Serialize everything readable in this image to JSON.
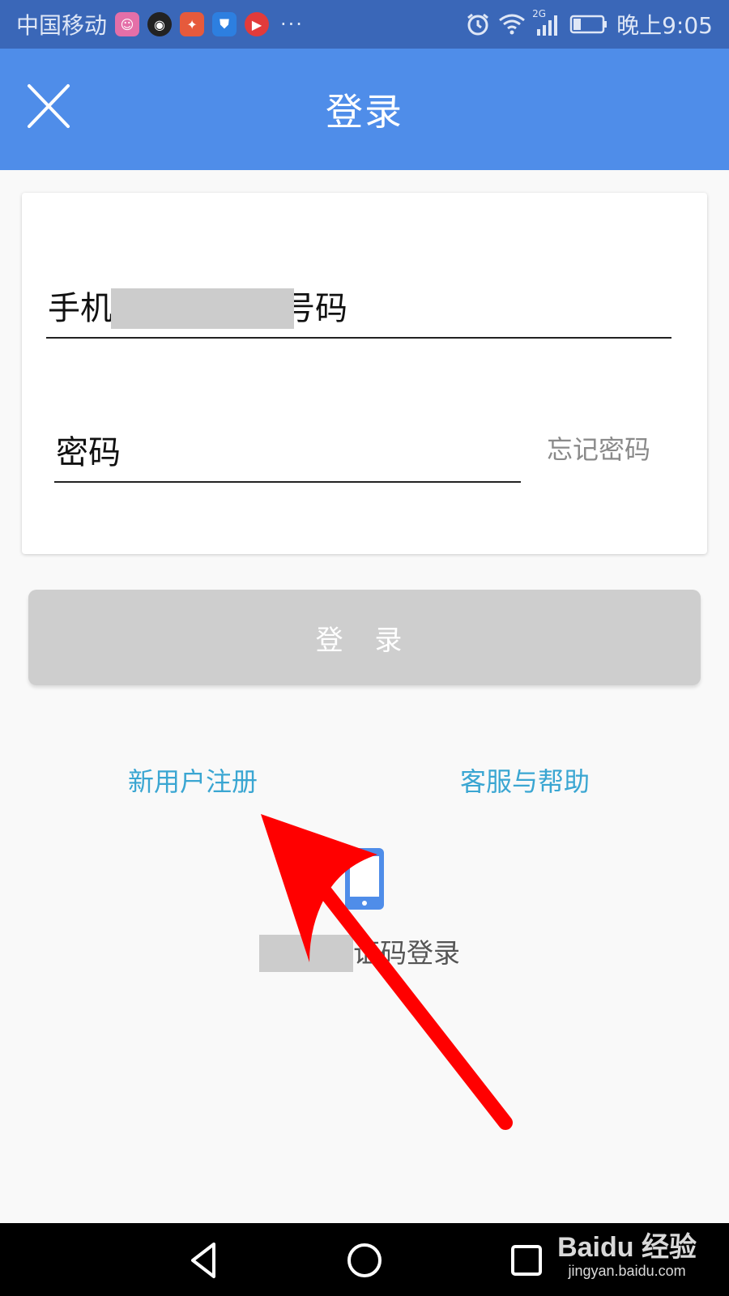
{
  "status_bar": {
    "carrier": "中国移动",
    "more": "···",
    "network": "2G",
    "time": "晚上9:05"
  },
  "header": {
    "title": "登录"
  },
  "form": {
    "phone_placeholder": "手机号码",
    "phone_visible_start": "手机",
    "phone_visible_end": "号码",
    "password_placeholder": "密码",
    "forgot_password": "忘记密码"
  },
  "login_button": {
    "label": "登 录"
  },
  "links": {
    "register": "新用户注册",
    "help": "客服与帮助"
  },
  "sms_login": {
    "label_visible": "证码登录"
  },
  "watermark": {
    "brand": "Baidu 经验",
    "url": "jingyan.baidu.com"
  },
  "colors": {
    "status_bar": "#3a67b8",
    "header": "#4f8de9",
    "link": "#3aa6d2",
    "button_disabled": "#cecece",
    "arrow": "#ff0000"
  }
}
